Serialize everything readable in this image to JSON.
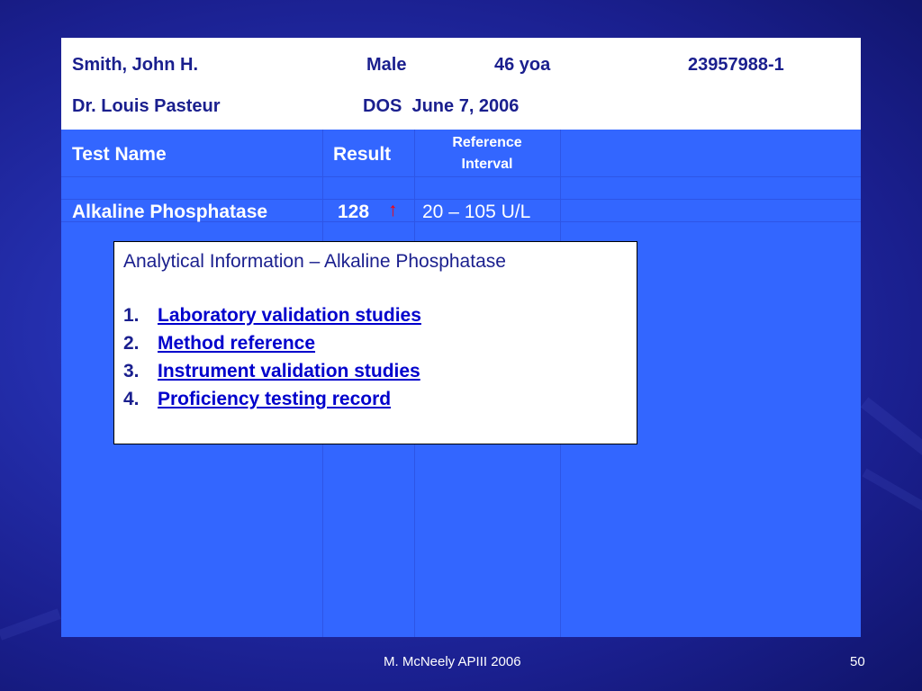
{
  "patient": {
    "name": "Smith, John H.",
    "sex": "Male",
    "age": "46 yoa",
    "id": "23957988-1",
    "doctor": "Dr. Louis Pasteur",
    "dos": "DOS  June 7, 2006"
  },
  "table": {
    "headers": {
      "test_name": "Test Name",
      "result": "Result",
      "reference_line1": "Reference",
      "reference_line2": "Interval"
    },
    "rows": [
      {
        "test": "Alkaline Phosphatase",
        "result": "128",
        "flag": "↑",
        "reference": "20 – 105 U/L"
      }
    ]
  },
  "info_box": {
    "title": "Analytical Information – Alkaline Phosphatase",
    "items": [
      {
        "number": "1.",
        "label": "Laboratory validation studies"
      },
      {
        "number": "2.",
        "label": "Method reference"
      },
      {
        "number": "3.",
        "label": "Instrument validation studies"
      },
      {
        "number": "4.",
        "label": "Proficiency testing record"
      }
    ]
  },
  "footer": {
    "author": "M. McNeely APIII 2006",
    "page": "50"
  },
  "colors": {
    "background": "#2530b0",
    "table_fill": "#3366ff",
    "text_navy": "#1a1f8e",
    "link": "#0000cc",
    "flag": "#ff0000"
  }
}
